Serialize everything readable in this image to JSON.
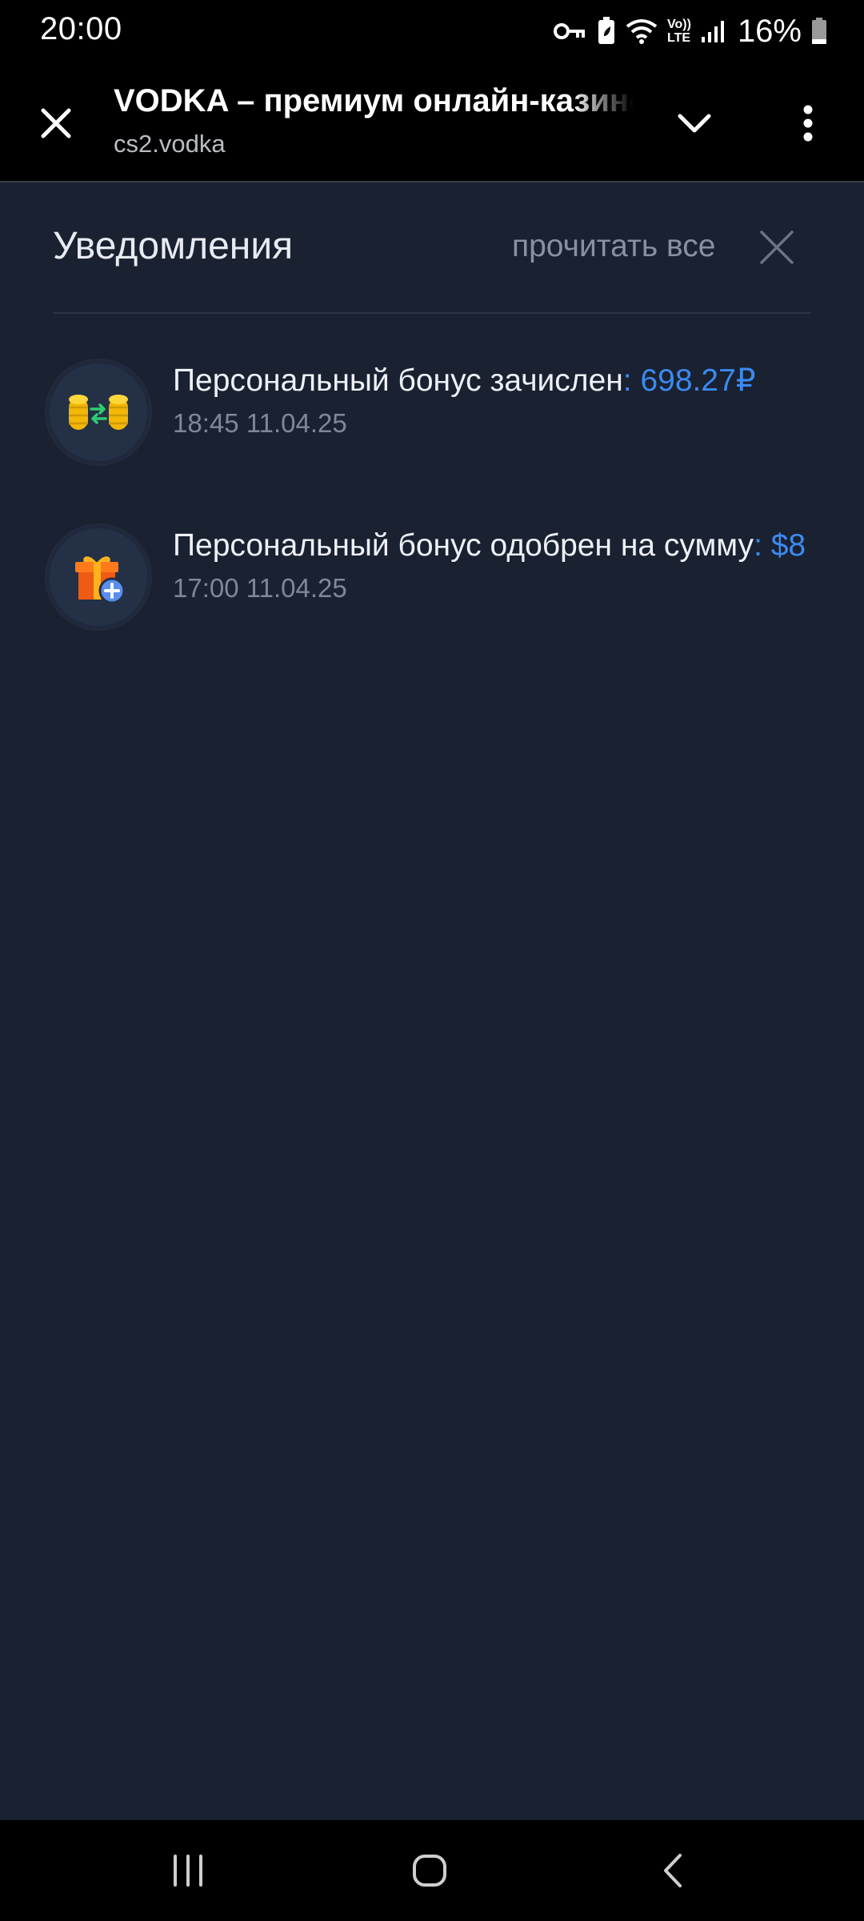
{
  "status_bar": {
    "time": "20:00",
    "battery": "16%",
    "icons": [
      "vpn-key-icon",
      "battery-saver-icon",
      "wifi-icon",
      "volte-icon",
      "signal-icon",
      "battery-icon"
    ],
    "volte_top": "Vo))",
    "volte_bottom": "LTE"
  },
  "browser": {
    "title": "VODKA – премиум онлайн-казино",
    "url": "cs2.vodka"
  },
  "notifications_panel": {
    "title": "Уведомления",
    "read_all_label": "прочитать все",
    "items": [
      {
        "icon": "coins-exchange-icon",
        "text": "Персональный бонус зачислен",
        "amount": ": 698.27₽",
        "time": "18:45 11.04.25"
      },
      {
        "icon": "gift-plus-icon",
        "text": "Персональный бонус одобрен на сумму",
        "amount": ": $8",
        "time": "17:00 11.04.25"
      }
    ]
  },
  "colors": {
    "background": "#1a2131",
    "accent": "#3b8af0",
    "muted_text": "#7f8798"
  }
}
